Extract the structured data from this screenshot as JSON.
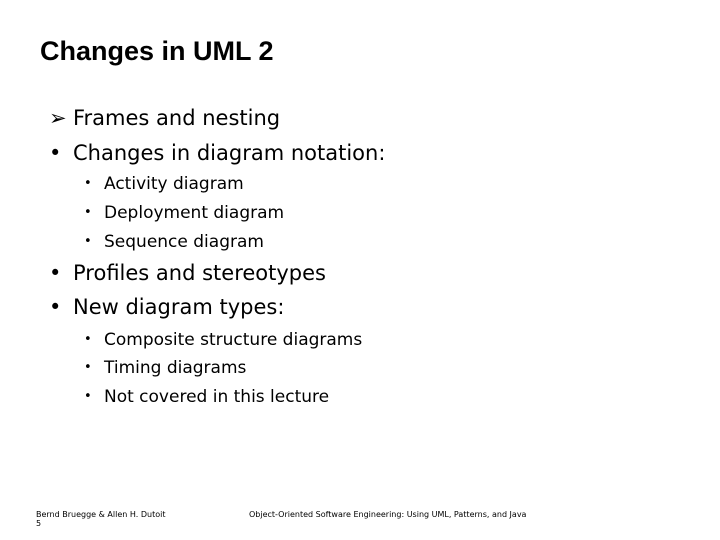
{
  "slide": {
    "title": "Changes in UML 2",
    "bullets": [
      {
        "marker": "➢",
        "text": "Frames and nesting"
      },
      {
        "marker": "•",
        "text": "Changes in diagram notation:",
        "children": [
          {
            "marker": "•",
            "text": "Activity diagram"
          },
          {
            "marker": "•",
            "text": "Deployment diagram"
          },
          {
            "marker": "•",
            "text": "Sequence diagram"
          }
        ]
      },
      {
        "marker": "•",
        "text": "Profiles and stereotypes"
      },
      {
        "marker": "•",
        "text": "New diagram types:",
        "children": [
          {
            "marker": "•",
            "text": "Composite structure diagrams"
          },
          {
            "marker": "•",
            "text": "Timing diagrams"
          },
          {
            "marker": "•",
            "text": "Not covered in this lecture"
          }
        ]
      }
    ]
  },
  "footer": {
    "authors": "Bernd Bruegge & Allen H. Dutoit",
    "page_number": "5",
    "book_title": "Object-Oriented Software Engineering: Using UML, Patterns, and Java"
  }
}
